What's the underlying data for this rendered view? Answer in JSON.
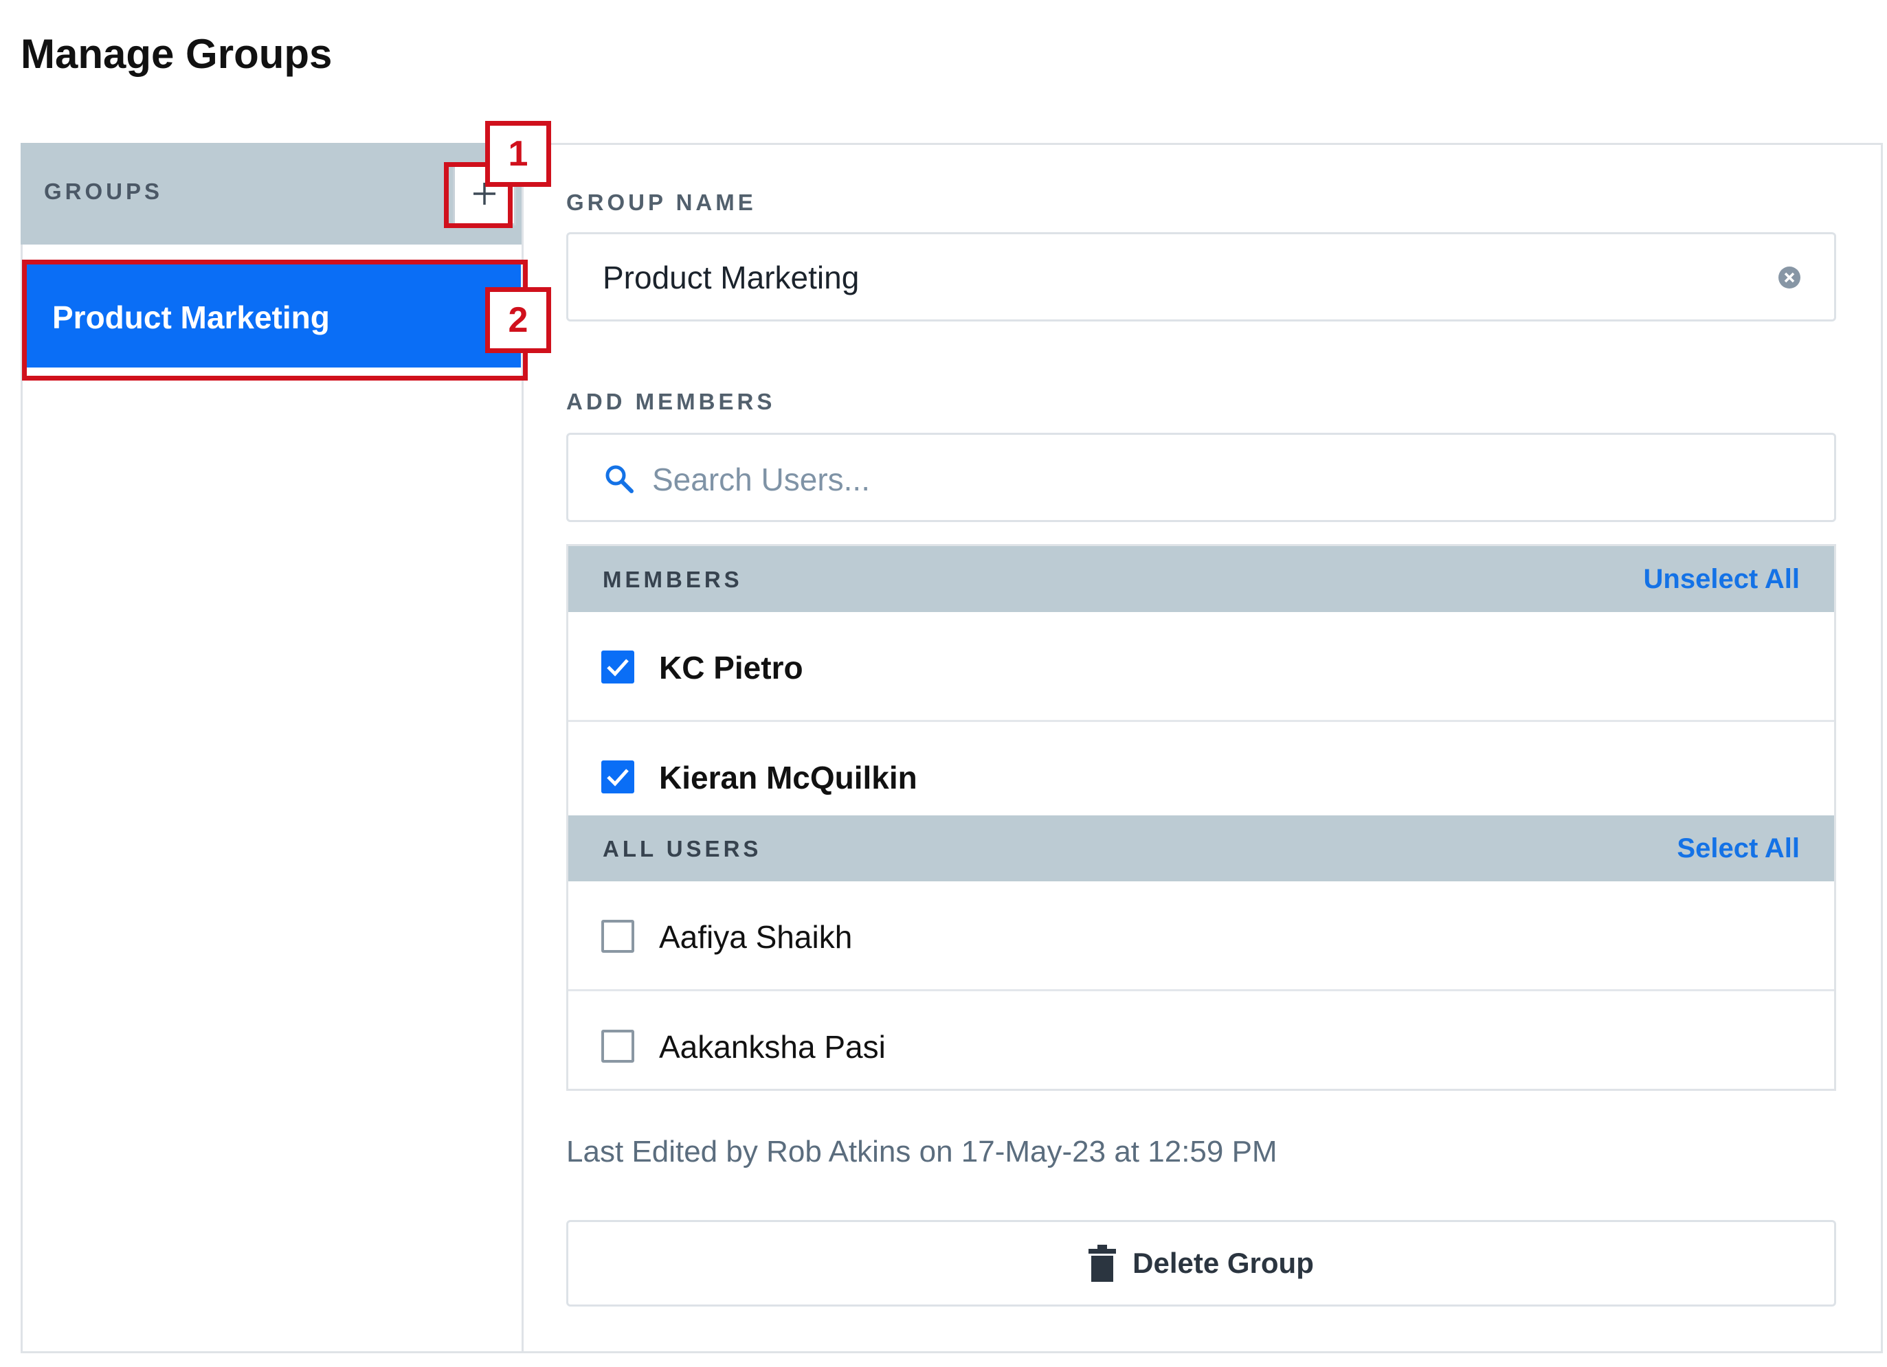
{
  "page": {
    "title": "Manage Groups"
  },
  "sidebar": {
    "header_title": "GROUPS",
    "add_icon": "plus-icon",
    "groups": [
      {
        "label": "Product Marketing",
        "selected": true
      }
    ]
  },
  "annotations": [
    {
      "label": "1"
    },
    {
      "label": "2"
    }
  ],
  "form": {
    "group_name_label": "GROUP NAME",
    "group_name_value": "Product Marketing",
    "add_members_label": "ADD MEMBERS",
    "search_placeholder": "Search Users..."
  },
  "members": {
    "header": "MEMBERS",
    "action": "Unselect All",
    "items": [
      {
        "name": "KC Pietro",
        "checked": true
      },
      {
        "name": "Kieran McQuilkin",
        "checked": true
      }
    ]
  },
  "all_users": {
    "header": "ALL USERS",
    "action": "Select All",
    "items": [
      {
        "name": "Aafiya Shaikh",
        "checked": false
      },
      {
        "name": "Aakanksha Pasi",
        "checked": false
      }
    ]
  },
  "footer": {
    "last_edited": "Last Edited by Rob Atkins on 17-May-23 at 12:59 PM",
    "delete_label": "Delete Group"
  },
  "colors": {
    "accent": "#0a6ef6",
    "header_bg": "#bccbd3",
    "link": "#1472e6",
    "callout": "#d0101c"
  }
}
